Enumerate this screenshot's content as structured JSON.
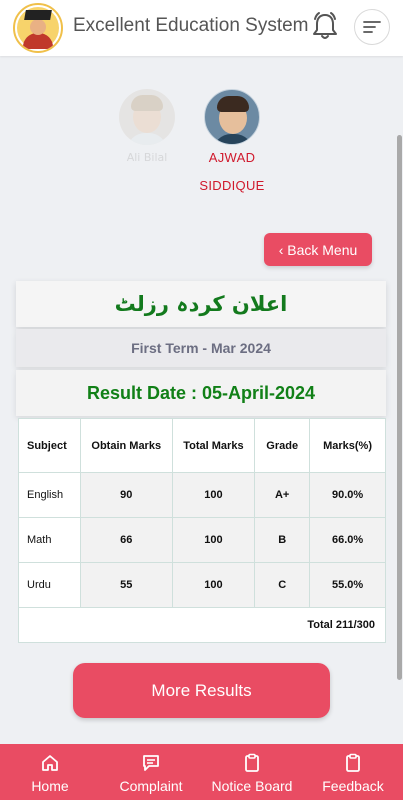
{
  "header": {
    "title": "Excellent Education System",
    "logo": "school-logo",
    "notification_icon": "bell-icon",
    "menu_icon": "menu-lines-icon"
  },
  "students": [
    {
      "name": "Ali Bilal",
      "selected": false
    },
    {
      "name": "AJWAD SIDDIQUE",
      "selected": true
    }
  ],
  "back_button": {
    "label": "‹ Back Menu"
  },
  "result": {
    "urdu_title": "اعلان کردہ رزلٹ",
    "term": "First Term - Mar 2024",
    "result_date": "Result Date : 05-April-2024",
    "columns": [
      "Subject",
      "Obtain Marks",
      "Total Marks",
      "Grade",
      "Marks(%)"
    ],
    "rows": [
      {
        "subject": "English",
        "obtain": "90",
        "total": "100",
        "grade": "A+",
        "percent": "90.0%"
      },
      {
        "subject": "Math",
        "obtain": "66",
        "total": "100",
        "grade": "B",
        "percent": "66.0%"
      },
      {
        "subject": "Urdu",
        "obtain": "55",
        "total": "100",
        "grade": "C",
        "percent": "55.0%"
      }
    ],
    "total": "Total 211/300"
  },
  "more_button": {
    "label": "More Results"
  },
  "bottom_nav": [
    {
      "label": "Home",
      "icon": "home-icon"
    },
    {
      "label": "Complaint",
      "icon": "message-icon"
    },
    {
      "label": "Notice Board",
      "icon": "clipboard-icon"
    },
    {
      "label": "Feedback",
      "icon": "clipboard-icon"
    }
  ],
  "colors": {
    "accent": "#e94c63",
    "urdu_title": "#137a1d",
    "result_date": "#118017",
    "selected_student": "#d0192c"
  }
}
